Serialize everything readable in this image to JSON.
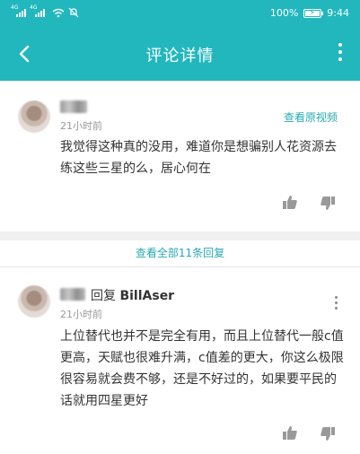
{
  "status_bar": {
    "battery": "100%",
    "time": "9:44",
    "signal_label": "4G",
    "battery_level": 1.0
  },
  "header": {
    "title": "评论详情"
  },
  "comment": {
    "time": "21小时前",
    "view_video": "查看原视频",
    "body": "我觉得这种真的没用，难道你是想骗别人花资源去练这些三星的么，居心何在"
  },
  "view_all_replies": "查看全部11条回复",
  "reply": {
    "reply_word": "回复",
    "reply_to": "BillAser",
    "time": "21小时前",
    "body": "上位替代也并不是完全有用，而且上位替代一般c值更高，天赋也很难升满，c值差的更大，你这么极限很容易就会费不够，还是不好过的，如果要平民的话就用四星更好"
  },
  "icons": [
    "signal-icon",
    "wifi-icon",
    "mute-icon",
    "battery-icon",
    "back-icon",
    "more-icon",
    "thumb-up-icon",
    "thumb-down-icon"
  ]
}
